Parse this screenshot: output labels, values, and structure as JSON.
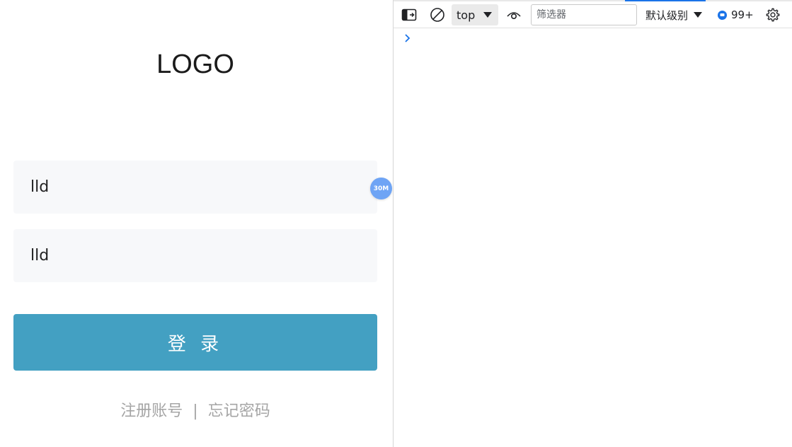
{
  "app": {
    "logo": "LOGO",
    "username_value": "lld",
    "password_value": "lld",
    "login_label": "登 录",
    "register_link": "注册账号",
    "separator": "|",
    "forgot_link": "忘记密码",
    "floating_badge": "30M"
  },
  "devtools": {
    "context": "top",
    "filter_placeholder": "筛选器",
    "level": "默认级别",
    "issues_count": "99+",
    "colors": {
      "accent": "#1a73e8",
      "login_button": "#43a0c2"
    },
    "icons": [
      "toggle-sidebar-icon",
      "clear-console-icon",
      "eye-icon",
      "message-icon",
      "gear-icon",
      "prompt-chevron-icon"
    ]
  }
}
